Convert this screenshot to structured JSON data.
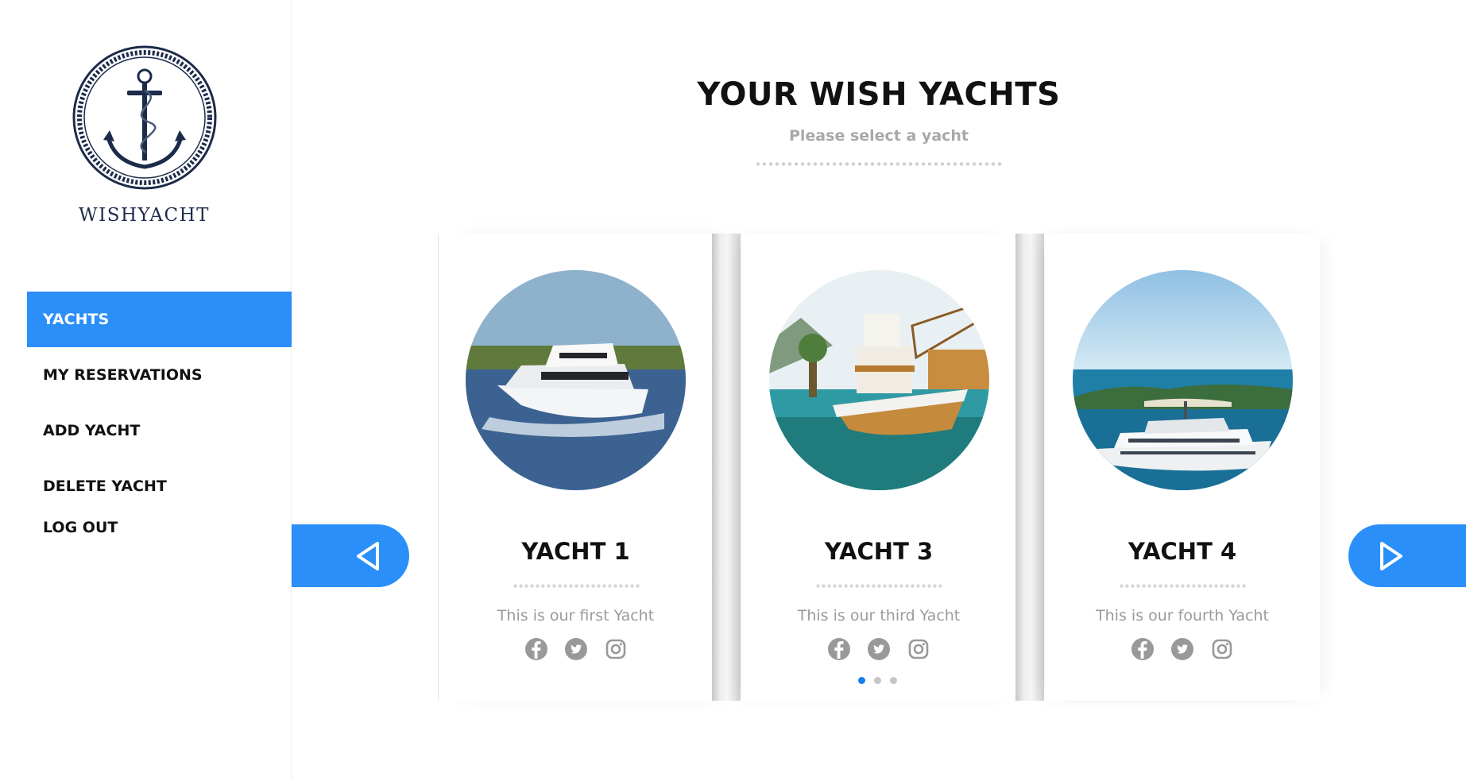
{
  "sidebar": {
    "brand": "WISHYACHT",
    "nav": [
      {
        "label": "YACHTS",
        "active": true
      },
      {
        "label": "MY RESERVATIONS",
        "active": false
      },
      {
        "label": "ADD YACHT",
        "active": false
      },
      {
        "label": "DELETE YACHT",
        "active": false
      },
      {
        "label": "LOG OUT",
        "active": false
      }
    ]
  },
  "header": {
    "title": "YOUR WISH YACHTS",
    "subtitle": "Please select a yacht"
  },
  "carousel": {
    "prev_icon": "triangle-left-icon",
    "next_icon": "triangle-right-icon",
    "cards": [
      {
        "title": "YACHT 1",
        "description": "This is our first Yacht",
        "image": "motor-yacht-photo"
      },
      {
        "title": "YACHT 3",
        "description": "This is our third Yacht",
        "image": "wooden-boat-photo"
      },
      {
        "title": "YACHT 4",
        "description": "This is our fourth Yacht",
        "image": "superyacht-island-photo"
      }
    ],
    "social_icons": [
      "facebook-icon",
      "twitter-icon",
      "instagram-icon"
    ],
    "pager": {
      "count": 3,
      "active_index": 0
    }
  },
  "colors": {
    "accent": "#2b8ff9",
    "brand_navy": "#1c2b4a",
    "muted_text": "#9a9a9a",
    "pager_active": "#1a7ef0"
  }
}
